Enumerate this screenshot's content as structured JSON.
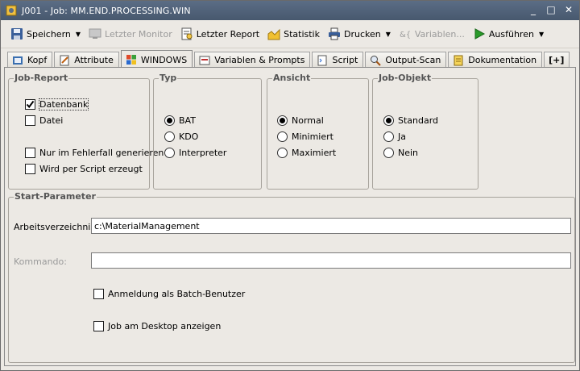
{
  "window": {
    "title": "J001 - Job: MM.END.PROCESSING.WIN",
    "controls": {
      "minimize": "_",
      "maximize": "□",
      "close": "✕"
    }
  },
  "toolbar": {
    "items": [
      {
        "label": "Speichern",
        "icon": "save-icon",
        "dropdown": true,
        "enabled": true
      },
      {
        "label": "Letzter Monitor",
        "icon": "monitor-icon",
        "dropdown": false,
        "enabled": false
      },
      {
        "label": "Letzter Report",
        "icon": "report-icon",
        "dropdown": false,
        "enabled": true
      },
      {
        "label": "Statistik",
        "icon": "statistics-icon",
        "dropdown": false,
        "enabled": true
      },
      {
        "label": "Drucken",
        "icon": "print-icon",
        "dropdown": true,
        "enabled": true
      },
      {
        "label": "Variablen...",
        "icon": "variables-icon",
        "dropdown": false,
        "enabled": false
      },
      {
        "label": "Ausführen",
        "icon": "run-icon",
        "dropdown": true,
        "enabled": true
      }
    ]
  },
  "tabs": [
    {
      "label": "Kopf",
      "icon": "header-icon",
      "active": false
    },
    {
      "label": "Attribute",
      "icon": "attributes-icon",
      "active": false
    },
    {
      "label": "WINDOWS",
      "icon": "windows-icon",
      "active": true
    },
    {
      "label": "Variablen & Prompts",
      "icon": "variables-prompts-icon",
      "active": false
    },
    {
      "label": "Script",
      "icon": "script-icon",
      "active": false
    },
    {
      "label": "Output-Scan",
      "icon": "output-scan-icon",
      "active": false
    },
    {
      "label": "Dokumentation",
      "icon": "documentation-icon",
      "active": false
    },
    {
      "label": "[+]",
      "icon": "",
      "active": false
    }
  ],
  "job_report": {
    "title": "Job-Report",
    "datenbank": {
      "label": "Datenbank",
      "checked": true
    },
    "datei": {
      "label": "Datei",
      "checked": false
    },
    "nur_fehler": {
      "label": "Nur im Fehlerfall generieren",
      "checked": false
    },
    "per_script": {
      "label": "Wird per Script erzeugt",
      "checked": false
    }
  },
  "typ": {
    "title": "Typ",
    "options": [
      "BAT",
      "KDO",
      "Interpreter"
    ],
    "selected": "BAT"
  },
  "ansicht": {
    "title": "Ansicht",
    "options": [
      "Normal",
      "Minimiert",
      "Maximiert"
    ],
    "selected": "Normal"
  },
  "job_objekt": {
    "title": "Job-Objekt",
    "options": [
      "Standard",
      "Ja",
      "Nein"
    ],
    "selected": "Standard"
  },
  "start_parameter": {
    "title": "Start-Parameter",
    "arbeitsverzeichnis_label": "Arbeitsverzeichnis:",
    "arbeitsverzeichnis_value": "c:\\MaterialManagement",
    "kommando_label": "Kommando:",
    "kommando_value": "",
    "batch_user": {
      "label": "Anmeldung als Batch-Benutzer",
      "checked": false
    },
    "desktop": {
      "label": "Job am Desktop anzeigen",
      "checked": false
    }
  }
}
